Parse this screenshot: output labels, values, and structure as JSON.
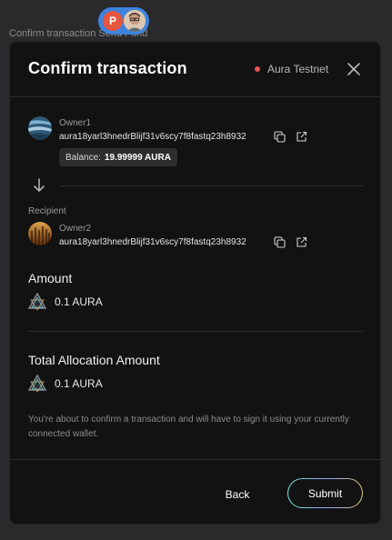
{
  "background": {
    "title": "Confirm transaction Send Fund"
  },
  "presence": {
    "initial": "P"
  },
  "modal": {
    "title": "Confirm transaction",
    "network": "Aura Testnet",
    "network_status_color": "#e9555a",
    "sender": {
      "name": "Owner1",
      "address": "aura18yarl3hnedrBlijf31v6scy7f8fastq23h8932",
      "balance_label": "Balance:",
      "balance_value": "19.99999 AURA"
    },
    "recipient": {
      "label": "Recipient",
      "name": "Owner2",
      "address": "aura18yarl3hnedrBlijf31v6scy7f8fastq23h8932"
    },
    "amount": {
      "label": "Amount",
      "value": "0.1 AURA"
    },
    "total": {
      "label": "Total Allocation Amount",
      "value": "0.1 AURA"
    },
    "note": "You're about to confirm a transaction and will have to sign it using your currently connected wallet.",
    "buttons": {
      "back": "Back",
      "submit": "Submit"
    }
  },
  "icons": {
    "close": "close-icon",
    "copy": "copy-icon",
    "external": "external-link-icon",
    "arrow": "arrow-down-icon",
    "token": "aura-token-icon"
  }
}
